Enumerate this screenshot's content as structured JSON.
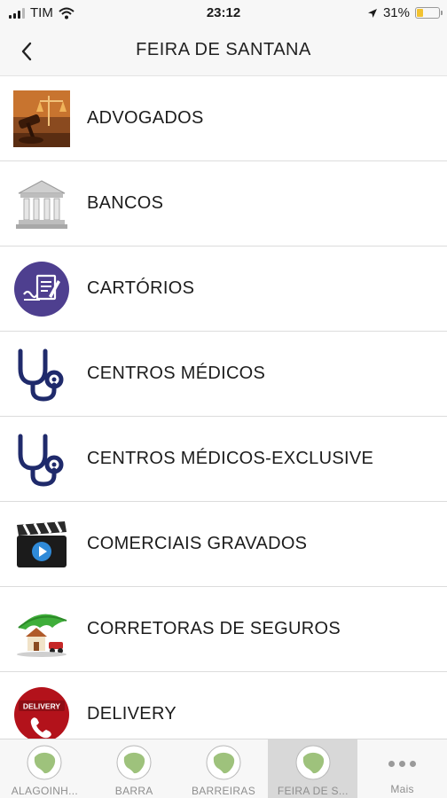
{
  "status_bar": {
    "carrier": "TIM",
    "time": "23:12",
    "battery_percent": "31%",
    "battery_level": 0.31,
    "icons": [
      "signal-icon",
      "wifi-icon",
      "location-arrow-icon",
      "battery-icon"
    ]
  },
  "nav": {
    "title": "FEIRA DE SANTANA",
    "back_icon": "chevron-left-icon"
  },
  "list": {
    "items": [
      {
        "label": "ADVOGADOS",
        "icon": "gavel-scales-icon"
      },
      {
        "label": "BANCOS",
        "icon": "bank-building-icon"
      },
      {
        "label": "CARTÓRIOS",
        "icon": "notary-document-icon"
      },
      {
        "label": "CENTROS MÉDICOS",
        "icon": "stethoscope-icon"
      },
      {
        "label": "CENTROS MÉDICOS-EXCLUSIVE",
        "icon": "stethoscope-icon"
      },
      {
        "label": "COMERCIAIS GRAVADOS",
        "icon": "clapperboard-play-icon"
      },
      {
        "label": "CORRETORAS DE SEGUROS",
        "icon": "insurance-umbrella-house-icon"
      },
      {
        "label": "DELIVERY",
        "icon": "delivery-phone-icon",
        "badge_text": "DELIVERY"
      }
    ]
  },
  "tab_bar": {
    "tabs": [
      {
        "label": "ALAGOINH...",
        "icon": "brazil-map-icon",
        "active": false
      },
      {
        "label": "BARRA",
        "icon": "brazil-map-icon",
        "active": false
      },
      {
        "label": "BARREIRAS",
        "icon": "brazil-map-icon",
        "active": false
      },
      {
        "label": "FEIRA DE S...",
        "icon": "brazil-map-icon",
        "active": true
      },
      {
        "label": "Mais",
        "icon": "more-dots-icon",
        "active": false
      }
    ]
  },
  "colors": {
    "bar_background": "#f7f7f7",
    "active_tab": "#d8d8d8",
    "notary_purple": "#4e3f8f",
    "stethoscope_navy": "#1f2a6b",
    "delivery_red": "#b3121b",
    "battery_yellow": "#f2c230"
  }
}
